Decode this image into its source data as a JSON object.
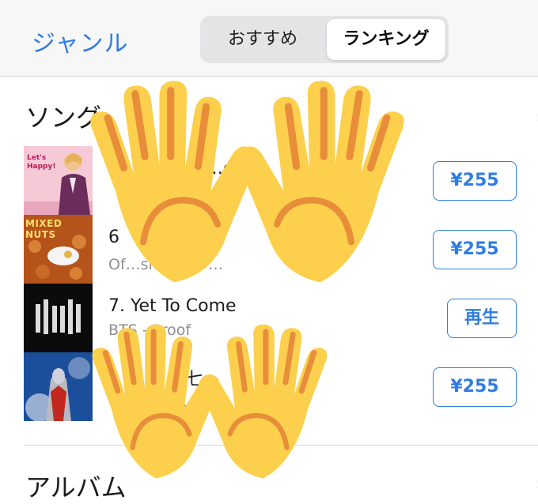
{
  "header": {
    "genre_link": "ジャンル",
    "segments": [
      "おすすめ",
      "ランキング"
    ],
    "selected_segment": "ランキング"
  },
  "sections": {
    "songs_title": "ソング",
    "albums_title": "アルバム"
  },
  "songs": [
    {
      "title": "…op",
      "subtitle": "",
      "button": "¥255",
      "button_type": "price"
    },
    {
      "title": "6",
      "subtitle": "Of…sm - …ツ…",
      "button": "¥255",
      "button_type": "price"
    },
    {
      "title": "7. Yet To Come",
      "subtitle": "BTS - Proof",
      "button": "再生",
      "button_type": "play"
    },
    {
      "title": "…七",
      "subtitle": "…1/七",
      "button": "¥255",
      "button_type": "price"
    }
  ],
  "artwork_text": {
    "art1": "Let's Happy!",
    "art2": "MIXED NUTS"
  },
  "overlay": {
    "icon": "raising-hands-emoji"
  },
  "colors": {
    "accent": "#2f7de1",
    "header_bg": "#f7f7f7",
    "hand_fill": "#fcd04d",
    "hand_line": "#e88d3a"
  }
}
